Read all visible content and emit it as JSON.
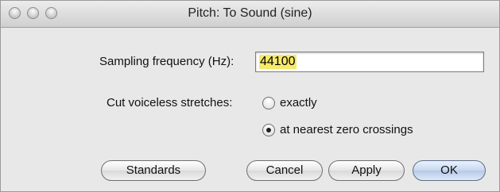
{
  "window": {
    "title": "Pitch: To Sound (sine)"
  },
  "form": {
    "sampling_label": "Sampling frequency (Hz):",
    "sampling_value": "44100",
    "cut_label": "Cut voiceless stretches:",
    "options": [
      {
        "label": "exactly",
        "selected": false
      },
      {
        "label": "at nearest zero crossings",
        "selected": true
      }
    ]
  },
  "buttons": {
    "standards": "Standards",
    "cancel": "Cancel",
    "apply": "Apply",
    "ok": "OK"
  }
}
